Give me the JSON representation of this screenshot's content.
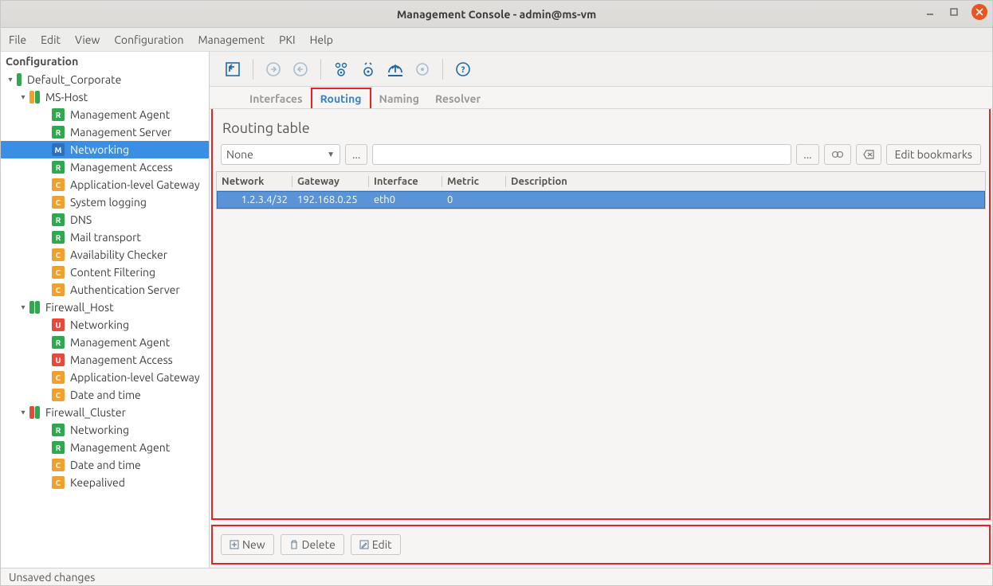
{
  "window": {
    "title": "Management Console - admin@ms-vm"
  },
  "menu": {
    "file": "File",
    "edit": "Edit",
    "view": "View",
    "configuration": "Configuration",
    "management": "Management",
    "pki": "PKI",
    "help": "Help"
  },
  "sidebar": {
    "header": "Configuration",
    "nodes": [
      {
        "lvl": 0,
        "label": "Default_Corporate",
        "exp": "▾",
        "badges": [
          {
            "t": "thin",
            "c": "green"
          }
        ]
      },
      {
        "lvl": 1,
        "label": "MS-Host",
        "exp": "▾",
        "badges": [
          {
            "t": "thin",
            "c": "orange"
          },
          {
            "t": "thin",
            "c": "green"
          }
        ]
      },
      {
        "lvl": 2,
        "label": "Management Agent",
        "badges": [
          {
            "t": "R",
            "c": "green"
          }
        ]
      },
      {
        "lvl": 2,
        "label": "Management Server",
        "badges": [
          {
            "t": "R",
            "c": "green"
          }
        ]
      },
      {
        "lvl": 2,
        "label": "Networking",
        "badges": [
          {
            "t": "M",
            "c": "blue"
          }
        ],
        "selected": true
      },
      {
        "lvl": 2,
        "label": "Management Access",
        "badges": [
          {
            "t": "R",
            "c": "green"
          }
        ]
      },
      {
        "lvl": 2,
        "label": "Application-level Gateway",
        "badges": [
          {
            "t": "C",
            "c": "orange"
          }
        ]
      },
      {
        "lvl": 2,
        "label": "System logging",
        "badges": [
          {
            "t": "C",
            "c": "orange"
          }
        ]
      },
      {
        "lvl": 2,
        "label": "DNS",
        "badges": [
          {
            "t": "R",
            "c": "green"
          }
        ]
      },
      {
        "lvl": 2,
        "label": "Mail transport",
        "badges": [
          {
            "t": "R",
            "c": "green"
          }
        ]
      },
      {
        "lvl": 2,
        "label": "Availability Checker",
        "badges": [
          {
            "t": "C",
            "c": "orange"
          }
        ]
      },
      {
        "lvl": 2,
        "label": "Content Filtering",
        "badges": [
          {
            "t": "C",
            "c": "orange"
          }
        ]
      },
      {
        "lvl": 2,
        "label": "Authentication Server",
        "badges": [
          {
            "t": "C",
            "c": "orange"
          }
        ]
      },
      {
        "lvl": 1,
        "label": "Firewall_Host",
        "exp": "▾",
        "badges": [
          {
            "t": "thin",
            "c": "green"
          },
          {
            "t": "thin",
            "c": "green"
          }
        ]
      },
      {
        "lvl": 2,
        "label": "Networking",
        "badges": [
          {
            "t": "U",
            "c": "red"
          }
        ]
      },
      {
        "lvl": 2,
        "label": "Management Agent",
        "badges": [
          {
            "t": "R",
            "c": "green"
          }
        ]
      },
      {
        "lvl": 2,
        "label": "Management Access",
        "badges": [
          {
            "t": "U",
            "c": "red"
          }
        ]
      },
      {
        "lvl": 2,
        "label": "Application-level Gateway",
        "badges": [
          {
            "t": "C",
            "c": "orange"
          }
        ]
      },
      {
        "lvl": 2,
        "label": "Date and time",
        "badges": [
          {
            "t": "C",
            "c": "orange"
          }
        ]
      },
      {
        "lvl": 1,
        "label": "Firewall_Cluster",
        "exp": "▾",
        "badges": [
          {
            "t": "thin",
            "c": "red"
          },
          {
            "t": "thin",
            "c": "green"
          }
        ]
      },
      {
        "lvl": 2,
        "label": "Networking",
        "badges": [
          {
            "t": "R",
            "c": "green"
          }
        ]
      },
      {
        "lvl": 2,
        "label": "Management Agent",
        "badges": [
          {
            "t": "R",
            "c": "green"
          }
        ]
      },
      {
        "lvl": 2,
        "label": "Date and time",
        "badges": [
          {
            "t": "C",
            "c": "orange"
          }
        ]
      },
      {
        "lvl": 2,
        "label": "Keepalived",
        "badges": [
          {
            "t": "C",
            "c": "orange"
          }
        ]
      }
    ]
  },
  "tabs": {
    "interfaces": "Interfaces",
    "routing": "Routing",
    "naming": "Naming",
    "resolver": "Resolver"
  },
  "section": {
    "title": "Routing table"
  },
  "filter": {
    "selected": "None",
    "ellipsis": "...",
    "bookmarks": "Edit bookmarks"
  },
  "table": {
    "headers": {
      "network": "Network",
      "gateway": "Gateway",
      "interface": "Interface",
      "metric": "Metric",
      "description": "Description"
    },
    "rows": [
      {
        "network": "1.2.3.4/32",
        "gateway": "192.168.0.25",
        "interface": "eth0",
        "metric": "0",
        "description": ""
      }
    ]
  },
  "actions": {
    "new": "New",
    "delete": "Delete",
    "edit": "Edit"
  },
  "status": {
    "text": "Unsaved changes"
  }
}
